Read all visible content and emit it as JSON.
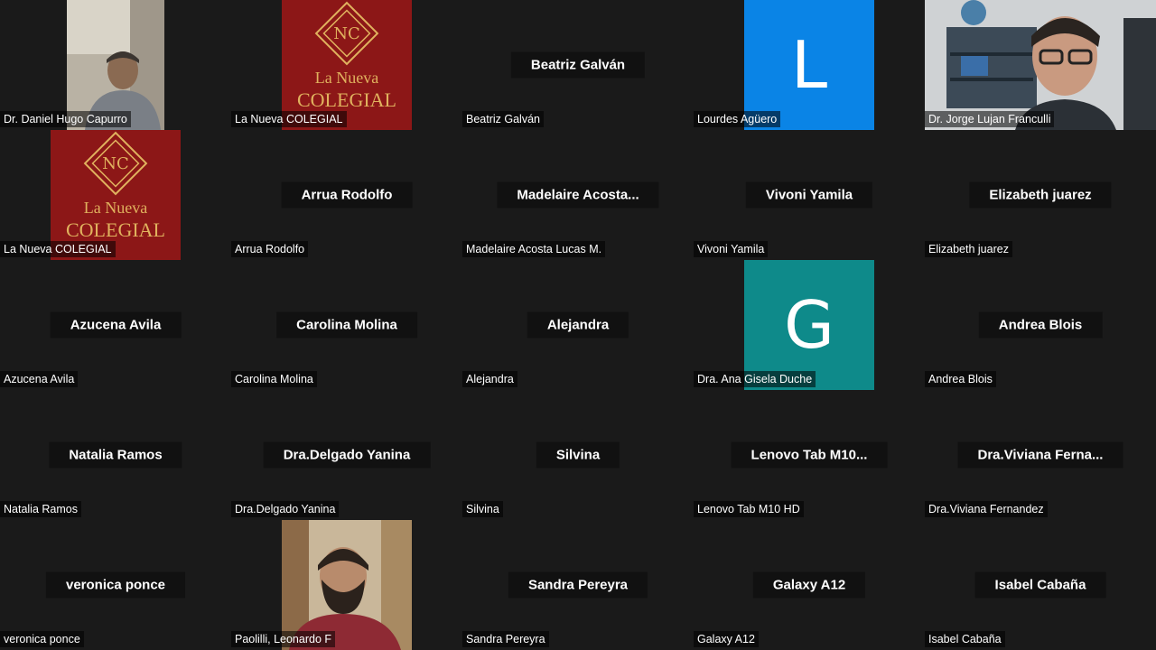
{
  "meeting": {
    "participants": [
      {
        "name": "Dr. Daniel Hugo Capurro",
        "display_text": "",
        "tile_type": "photo",
        "photo": "elderly-man-room"
      },
      {
        "name": "La Nueva COLEGIAL",
        "display_text": "",
        "tile_type": "logo",
        "logo_line1": "La Nueva",
        "logo_line2": "COLEGIAL",
        "logo_monogram": "NC"
      },
      {
        "name": "Beatriz Galván",
        "display_text": "Beatriz Galván",
        "tile_type": "name"
      },
      {
        "name": "Lourdes Agüero",
        "display_text": "",
        "tile_type": "avatar",
        "avatar_letter": "L",
        "avatar_color": "#0a84e6"
      },
      {
        "name": "Dr. Jorge Lujan Franculli",
        "display_text": "",
        "tile_type": "photo",
        "photo": "man-glasses-bookshelf"
      },
      {
        "name": "La Nueva COLEGIAL",
        "display_text": "",
        "tile_type": "logo",
        "logo_line1": "La Nueva",
        "logo_line2": "COLEGIAL",
        "logo_monogram": "NC"
      },
      {
        "name": "Arrua Rodolfo",
        "display_text": "Arrua Rodolfo",
        "tile_type": "name"
      },
      {
        "name": "Madelaire  Acosta Lucas M.",
        "display_text": "Madelaire  Acosta...",
        "tile_type": "name"
      },
      {
        "name": "Vivoni Yamila",
        "display_text": "Vivoni Yamila",
        "tile_type": "name"
      },
      {
        "name": "Elizabeth juarez",
        "display_text": "Elizabeth juarez",
        "tile_type": "name"
      },
      {
        "name": "Azucena Avila",
        "display_text": "Azucena Avila",
        "tile_type": "name"
      },
      {
        "name": "Carolina Molina",
        "display_text": "Carolina Molina",
        "tile_type": "name"
      },
      {
        "name": "Alejandra",
        "display_text": "Alejandra",
        "tile_type": "name"
      },
      {
        "name": "Dra. Ana Gisela Duche",
        "display_text": "",
        "tile_type": "avatar",
        "avatar_letter": "G",
        "avatar_color": "#0e8a8a"
      },
      {
        "name": "Andrea Blois",
        "display_text": "Andrea Blois",
        "tile_type": "name"
      },
      {
        "name": "Natalia Ramos",
        "display_text": "Natalia Ramos",
        "tile_type": "name"
      },
      {
        "name": "Dra.Delgado Yanina",
        "display_text": "Dra.Delgado Yanina",
        "tile_type": "name"
      },
      {
        "name": "Silvina",
        "display_text": "Silvina",
        "tile_type": "name"
      },
      {
        "name": "Lenovo Tab M10 HD",
        "display_text": "Lenovo Tab M10...",
        "tile_type": "name"
      },
      {
        "name": "Dra.Viviana Fernandez",
        "display_text": "Dra.Viviana  Ferna...",
        "tile_type": "name"
      },
      {
        "name": "veronica ponce",
        "display_text": "veronica ponce",
        "tile_type": "name"
      },
      {
        "name": "Paolilli, Leonardo F",
        "display_text": "",
        "tile_type": "photo",
        "photo": "bearded-man-hoodie"
      },
      {
        "name": "Sandra Pereyra",
        "display_text": "Sandra Pereyra",
        "tile_type": "name"
      },
      {
        "name": "Galaxy A12",
        "display_text": "Galaxy A12",
        "tile_type": "name"
      },
      {
        "name": "Isabel Cabaña",
        "display_text": "Isabel Cabaña",
        "tile_type": "name"
      }
    ]
  }
}
